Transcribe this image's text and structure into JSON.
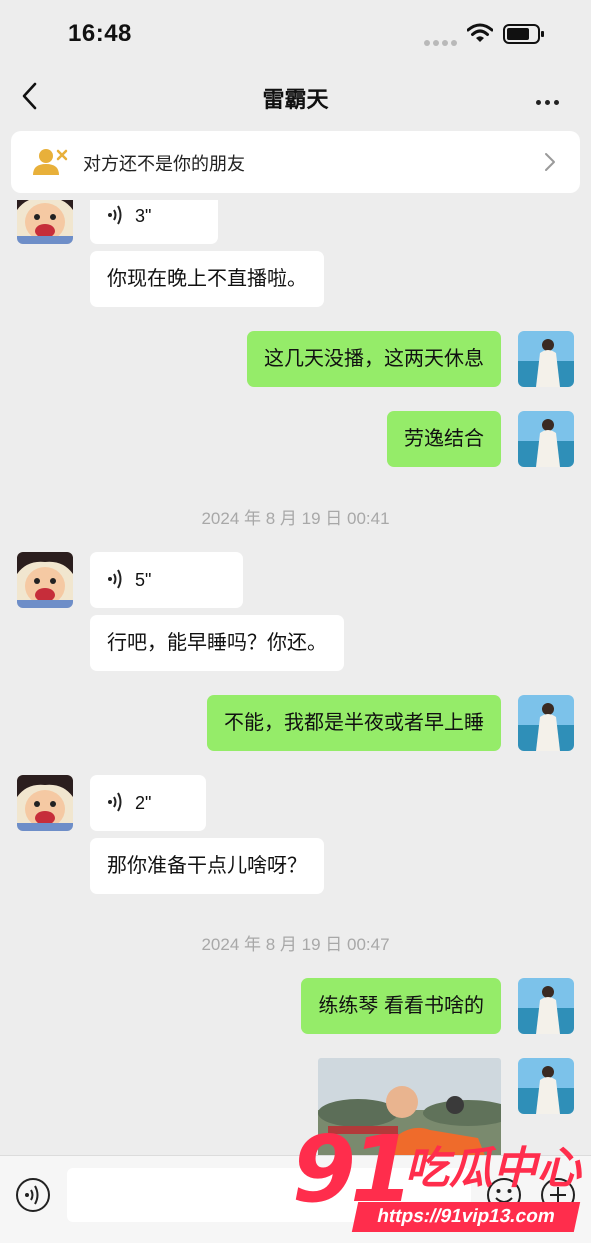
{
  "status_bar": {
    "time": "16:48"
  },
  "nav": {
    "title": "雷霸天"
  },
  "banner": {
    "text": "对方还不是你的朋友"
  },
  "messages": {
    "m1_duration": "3\"",
    "m2_text": "你现在晚上不直播啦。",
    "m3_text": "这几天没播，这两天休息",
    "m4_text": "劳逸结合",
    "ts1": "2024 年 8 月 19 日 00:41",
    "m5_duration": "5\"",
    "m6_text": "行吧，能早睡吗？你还。",
    "m7_text": "不能，我都是半夜或者早上睡",
    "m8_duration": "2\"",
    "m9_text": "那你准备干点儿啥呀？",
    "ts2": "2024 年 8 月 19 日 00:47",
    "m10_text": "练练琴 看看书啥的"
  },
  "watermark": {
    "number": "91",
    "name": "吃瓜中心",
    "url": "https://91vip13.com"
  },
  "colors": {
    "outgoing_bubble": "#95ec69",
    "incoming_bubble": "#ffffff",
    "background": "#ededed",
    "watermark": "#ff2d4c"
  },
  "icons": [
    "back-arrow",
    "more-dots",
    "user-x",
    "chevron-right",
    "voice-wave",
    "voice-toggle",
    "emoji",
    "plus"
  ]
}
